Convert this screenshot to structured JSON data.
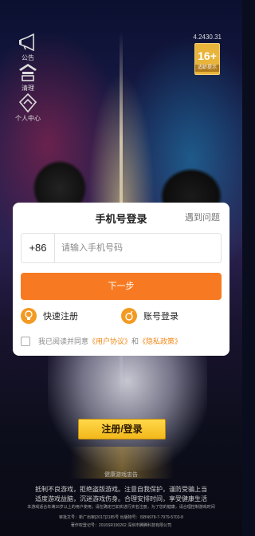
{
  "sidebar": {
    "items": [
      {
        "label": "公告",
        "icon": "megaphone-icon"
      },
      {
        "label": "清理",
        "icon": "broom-icon"
      },
      {
        "label": "个人中心",
        "icon": "user-center-icon"
      }
    ]
  },
  "version": "4.2430.31",
  "age_rating": {
    "number": "16+",
    "tip": "适龄提示"
  },
  "login": {
    "title": "手机号登录",
    "help": "遇到问题",
    "country_code": "+86",
    "phone_placeholder": "请输入手机号码",
    "next_label": "下一步",
    "quick_register": "快速注册",
    "account_login": "账号登录",
    "agree_prefix": "我已阅读并同意",
    "user_agreement": "《用户协议》",
    "and": "和",
    "privacy_policy": "《隐私政策》"
  },
  "register_button": "注册/登录",
  "footer": {
    "title": "健康游戏忠告",
    "line1": "抵制不良游戏，拒绝盗版游戏。注意自我保护，谨防受骗上当",
    "line2": "适度游戏益脑，沉迷游戏伤身。合理安排时间，享受健康生活",
    "line3": "本游戏适合年满16岁以上的用户使用；请在确定已如实进行实名注册，为了您的健康，请合理控制游戏时间",
    "line4": "审批文号：新广出审[2017]2185号 出版物号：ISBN978-7-7979-5703-8",
    "line5": "著作权登记号：2016SR190262 深圳市腾腾科技有限公司"
  },
  "colors": {
    "accent": "#f77a22",
    "gold": "#f2b81a"
  }
}
